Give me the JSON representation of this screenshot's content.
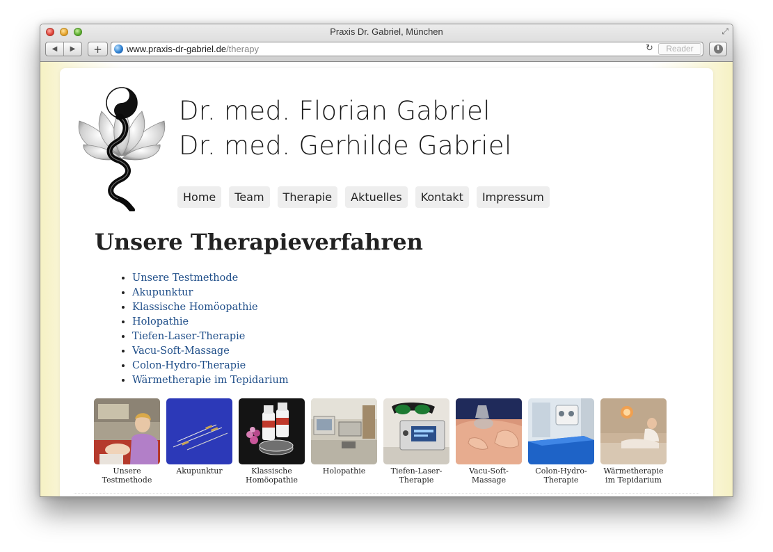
{
  "window": {
    "title": "Praxis Dr. Gabriel, München"
  },
  "toolbar": {
    "back_icon": "◀",
    "forward_icon": "▶",
    "add_icon": "+",
    "url_domain": "www.praxis-dr-gabriel.de",
    "url_path": "/therapy",
    "reload_icon": "↻",
    "reader_label": "Reader"
  },
  "header": {
    "line1": "Dr. med. Florian Gabriel",
    "line2": "Dr. med. Gerhilde Gabriel"
  },
  "nav": [
    "Home",
    "Team",
    "Therapie",
    "Aktuelles",
    "Kontakt",
    "Impressum"
  ],
  "main": {
    "title": "Unsere Therapieverfahren",
    "list": [
      "Unsere Testmethode",
      "Akupunktur",
      "Klassische Homöopathie",
      "Holopathie",
      "Tiefen-Laser-Therapie",
      "Vacu-Soft-Massage",
      "Colon-Hydro-Therapie",
      "Wärmetherapie im Tepidarium"
    ],
    "gallery": [
      {
        "line1": "Unsere",
        "line2": "Testmethode"
      },
      {
        "line1": "Akupunktur",
        "line2": ""
      },
      {
        "line1": "Klassische",
        "line2": "Homöopathie"
      },
      {
        "line1": "Holopathie",
        "line2": ""
      },
      {
        "line1": "Tiefen-Laser-",
        "line2": "Therapie"
      },
      {
        "line1": "Vacu-Soft-",
        "line2": "Massage"
      },
      {
        "line1": "Colon-Hydro-",
        "line2": "Therapie"
      },
      {
        "line1": "Wärmetherapie",
        "line2": "im Tepidarium"
      }
    ]
  },
  "colors": {
    "link": "#1e4d88",
    "nav_bg": "#eeeeee",
    "page_bg": "#f8f5d6"
  }
}
